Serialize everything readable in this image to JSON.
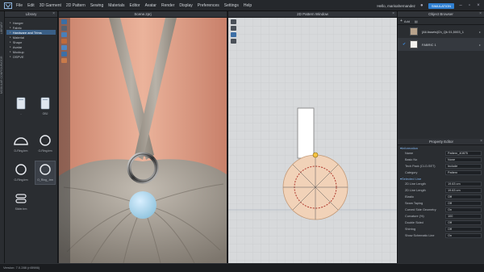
{
  "menubar": {
    "items": [
      "File",
      "Edit",
      "3D Garment",
      "2D Pattern",
      "Sewing",
      "Materials",
      "Editor",
      "Avatar",
      "Render",
      "Display",
      "Preferences",
      "Settings",
      "Help"
    ],
    "user": "Hello, marisahernandez",
    "simulation": "SIMULATION"
  },
  "sidebar_strip": {
    "labels": [
      "LIBRARY",
      "MODULAR CONFIGURATOR"
    ]
  },
  "library": {
    "title": "Library",
    "tree": [
      {
        "label": "Hanger",
        "selected": false
      },
      {
        "label": "Fabric",
        "selected": false
      },
      {
        "label": "Hardware and Trims",
        "selected": true
      },
      {
        "label": "Material",
        "selected": false
      },
      {
        "label": "Shape",
        "selected": false
      },
      {
        "label": "Avatar",
        "selected": false
      },
      {
        "label": "Mockup",
        "selected": false
      },
      {
        "label": "OSPVE",
        "selected": false
      }
    ],
    "thumbs": [
      {
        "label": "..",
        "icon": "folder-icon"
      },
      {
        "label": "OBJ",
        "icon": "folder-icon"
      },
      {
        "label": "D-Ring.trm",
        "icon": "d-ring-icon"
      },
      {
        "label": "O-Ring.trm",
        "icon": "o-ring-icon"
      },
      {
        "label": "O-Ring.trm",
        "icon": "o-ring-icon"
      },
      {
        "label": "O_Ring_.trm",
        "icon": "o-ring-icon"
      },
      {
        "label": "Slider.trm",
        "icon": "slider-icon"
      }
    ]
  },
  "view3d": {
    "title": "Scene.zprj"
  },
  "view2d": {
    "title": "2D Pattern Window"
  },
  "object_browser": {
    "title": "Object Browser",
    "add_label": "Add",
    "fabrics": [
      {
        "name": "[All Assets]Ch_Qk 01,5003_1",
        "color": "#b8a38c",
        "selected": false
      },
      {
        "name": "FABRIC 1",
        "color": "#f4f2ee",
        "selected": true
      }
    ]
  },
  "property_editor": {
    "title": "Property Editor",
    "sections": [
      {
        "name": "Information",
        "rows": [
          {
            "label": "Name",
            "value": "Pattern_40875"
          },
          {
            "label": "Basic No",
            "value": "None"
          },
          {
            "label": "Tech Pack (CLO-SET)",
            "value": "Include"
          },
          {
            "label": "Category",
            "value": "Pattern"
          }
        ]
      },
      {
        "name": "Selected Line",
        "rows": [
          {
            "label": "2D Line Length",
            "value": "19.63 cm"
          },
          {
            "label": "2D Line Length",
            "value": "19.63 cm"
          },
          {
            "label": "Elastic",
            "value": "Off"
          },
          {
            "label": "Seam Taping",
            "value": "Off"
          },
          {
            "label": "Curved Side Geometry",
            "value": "On"
          },
          {
            "label": "Curvature (%)",
            "value": "100"
          },
          {
            "label": "Double Sided",
            "value": "Off"
          },
          {
            "label": "Shirring",
            "value": "Off"
          },
          {
            "label": "Show Schematic Line",
            "value": "On"
          }
        ]
      }
    ]
  },
  "status": {
    "text": "Version: 7.0.288 (r45986)"
  },
  "colors": {
    "accent": "#2f7fd1",
    "selection": "#3a5f86",
    "grid_bg": "#d4d6d8",
    "skin": "#e7a48a",
    "fabric": "#a49b8f",
    "button": "#b9dced"
  }
}
